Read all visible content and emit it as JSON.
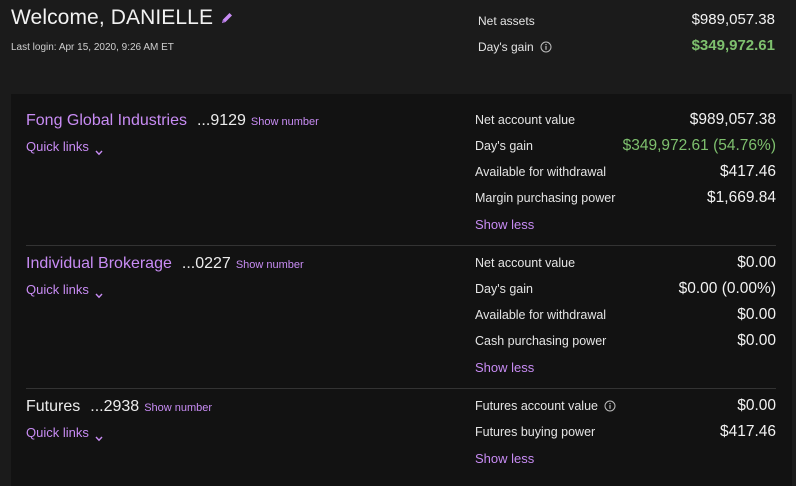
{
  "header": {
    "welcome": "Welcome, DANIELLE",
    "last_login": "Last login: Apr 15, 2020, 9:26 AM ET",
    "net_assets_label": "Net assets",
    "net_assets_value": "$989,057.38",
    "days_gain_label": "Day's gain",
    "days_gain_value": "$349,972.61"
  },
  "accounts": [
    {
      "name": "Fong Global Industries",
      "number": "...9129",
      "show_number": "Show number",
      "quick_links": "Quick links",
      "rows": [
        {
          "label": "Net account value",
          "value": "$989,057.38"
        },
        {
          "label": "Day's gain",
          "value": "$349,972.61 (54.76%)"
        },
        {
          "label": "Available for withdrawal",
          "value": "$417.46"
        },
        {
          "label": "Margin purchasing power",
          "value": "$1,669.84"
        }
      ],
      "show_less": "Show less"
    },
    {
      "name": "Individual Brokerage",
      "number": "...0227",
      "show_number": "Show number",
      "quick_links": "Quick links",
      "rows": [
        {
          "label": "Net account value",
          "value": "$0.00"
        },
        {
          "label": "Day's gain",
          "value": "$0.00 (0.00%)"
        },
        {
          "label": "Available for withdrawal",
          "value": "$0.00"
        },
        {
          "label": "Cash purchasing power",
          "value": "$0.00"
        }
      ],
      "show_less": "Show less"
    },
    {
      "name": "Futures",
      "number": "...2938",
      "show_number": "Show number",
      "quick_links": "Quick links",
      "rows": [
        {
          "label": "Futures account value",
          "value": "$0.00"
        },
        {
          "label": "Futures buying power",
          "value": "$417.46"
        }
      ],
      "show_less": "Show less"
    }
  ],
  "colors": {
    "accent": "#c88cf4",
    "gain": "#7ec06e",
    "background": "#1b1b1b",
    "panel": "#121212"
  },
  "icons": {
    "edit": "pencil-icon",
    "info": "info-icon",
    "chevron": "chevron-down-icon"
  }
}
